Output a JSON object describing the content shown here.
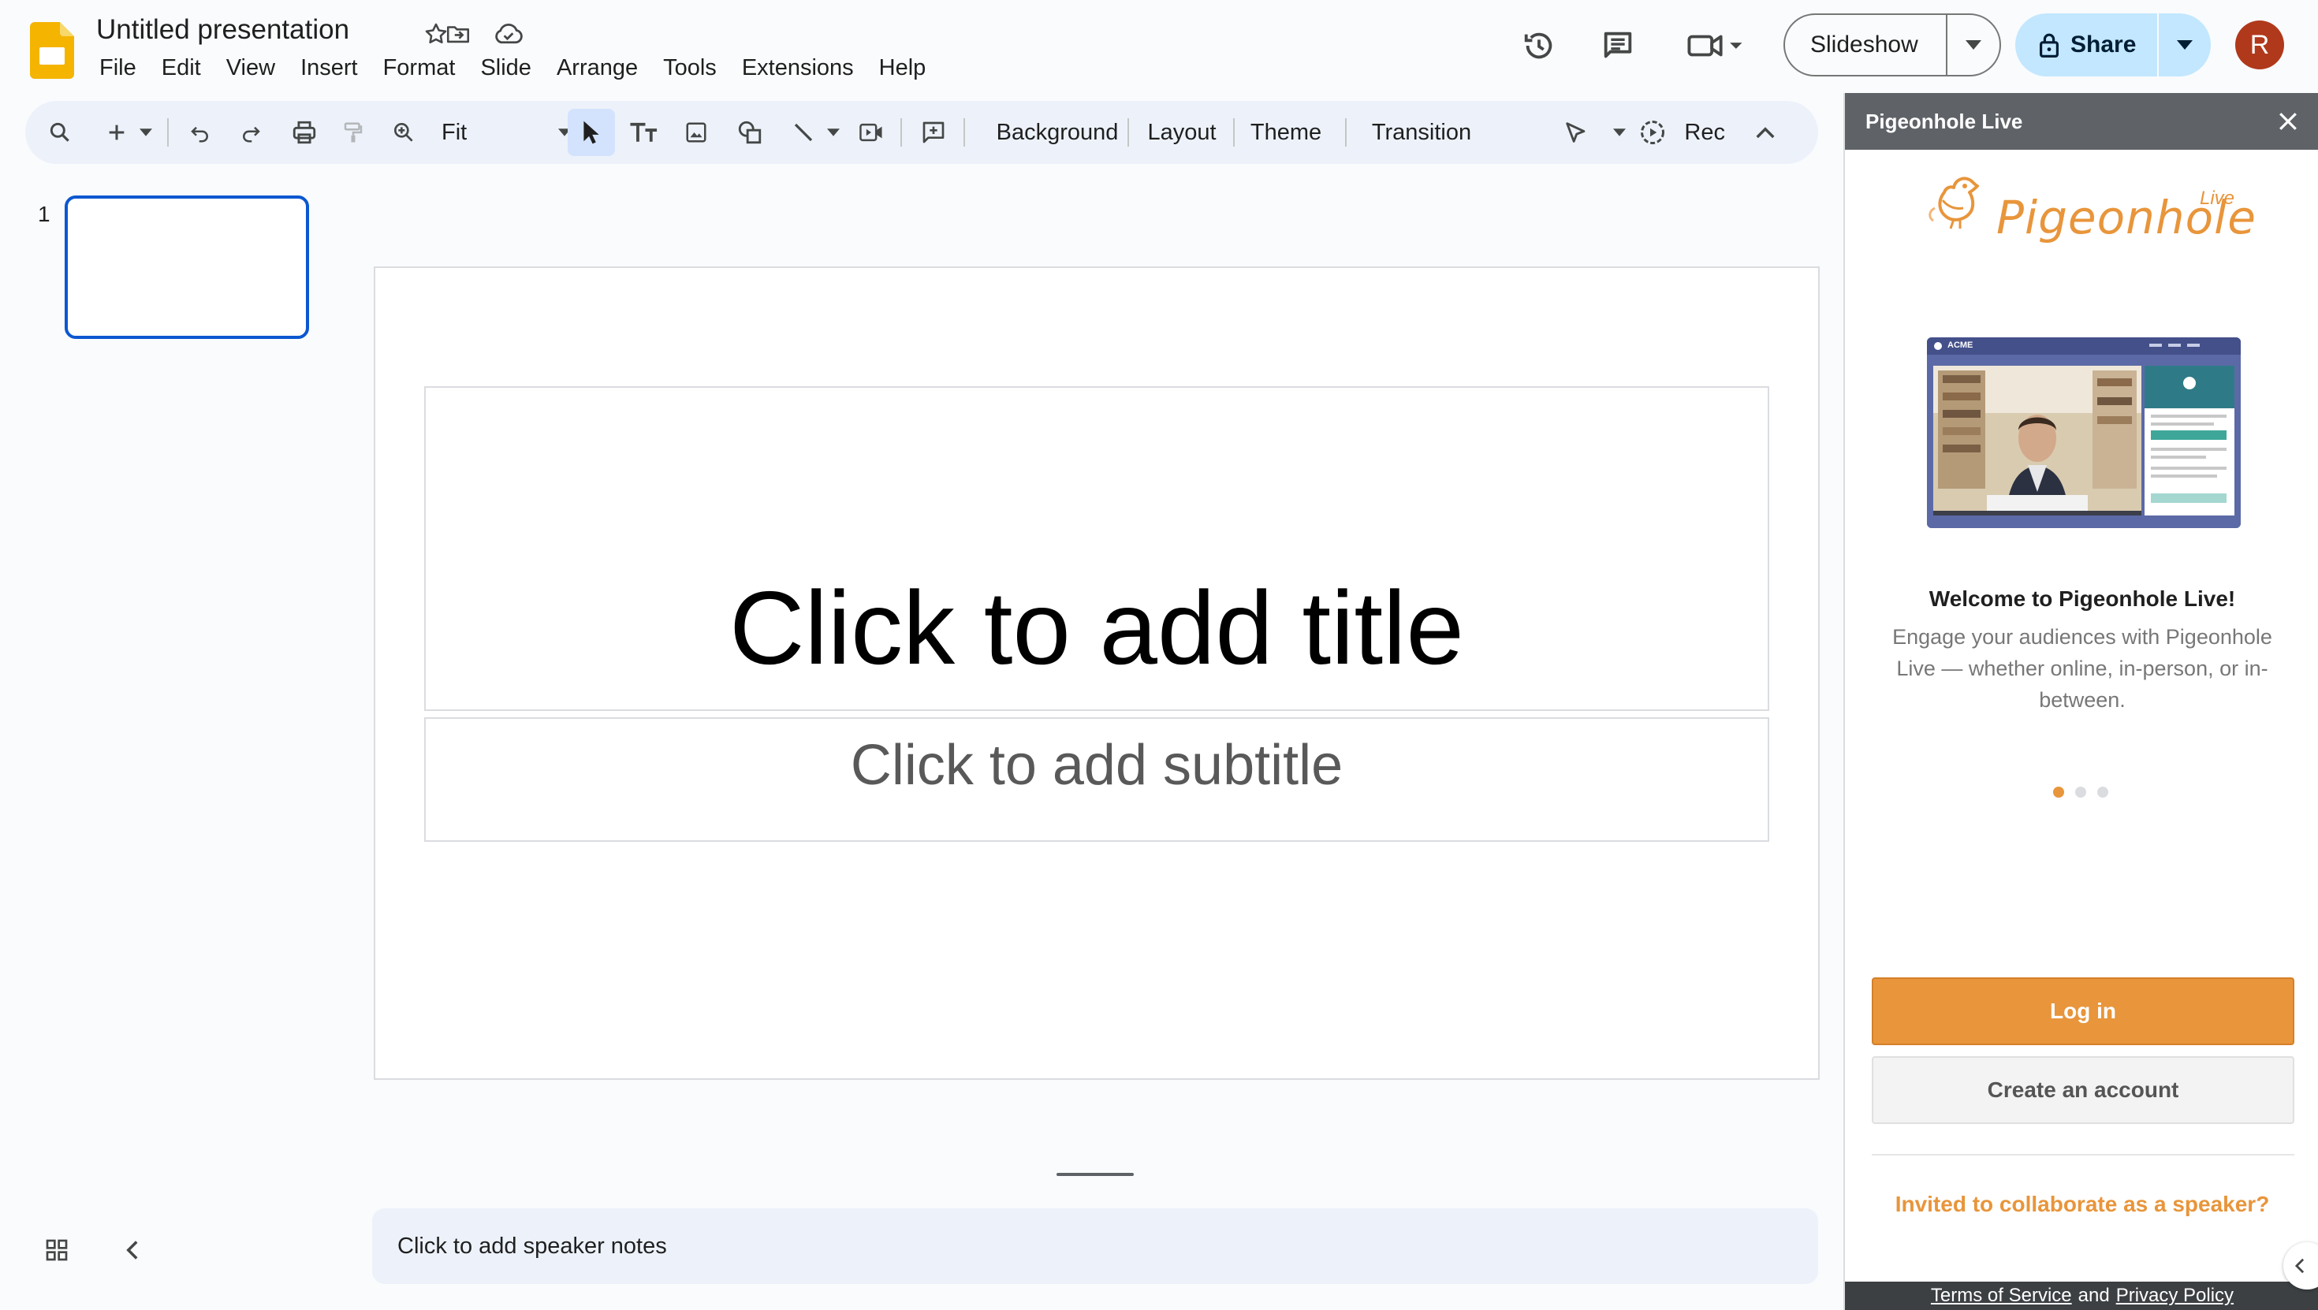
{
  "app": {
    "title": "Untitled presentation",
    "icons": [
      "star-icon",
      "move-to-folder-icon",
      "cloud-saved-icon"
    ],
    "menu": [
      "File",
      "Edit",
      "View",
      "Insert",
      "Format",
      "Slide",
      "Arrange",
      "Tools",
      "Extensions",
      "Help"
    ]
  },
  "header": {
    "slideshow_label": "Slideshow",
    "share_label": "Share",
    "avatar_letter": "R",
    "brand_color": "#f4b400",
    "share_bg": "#c2e7ff",
    "avatar_color": "#b0391b"
  },
  "toolbar": {
    "zoom_value": "Fit",
    "background_label": "Background",
    "layout_label": "Layout",
    "theme_label": "Theme",
    "transition_label": "Transition",
    "rec_label": "Rec"
  },
  "filmstrip": {
    "slides": [
      {
        "number": "1",
        "selected": true
      }
    ]
  },
  "slide": {
    "title_placeholder": "Click to add title",
    "subtitle_placeholder": "Click to add subtitle"
  },
  "notes": {
    "placeholder": "Click to add speaker notes"
  },
  "sidepanel": {
    "header_title": "Pigeonhole Live",
    "logo_text": "Pigeonhole",
    "logo_badge": "Live",
    "promo_brand": "ACME",
    "welcome_title": "Welcome to Pigeonhole Live!",
    "welcome_body": "Engage your audiences with Pigeonhole Live — whether online, in-person, or in-between.",
    "carousel": {
      "count": 3,
      "active": 1
    },
    "login_label": "Log in",
    "create_label": "Create an account",
    "invite_label": "Invited to collaborate as a speaker?",
    "footer": {
      "tos": "Terms of Service",
      "and": "and",
      "privacy": "Privacy Policy"
    },
    "accent_color": "#e8953b"
  }
}
